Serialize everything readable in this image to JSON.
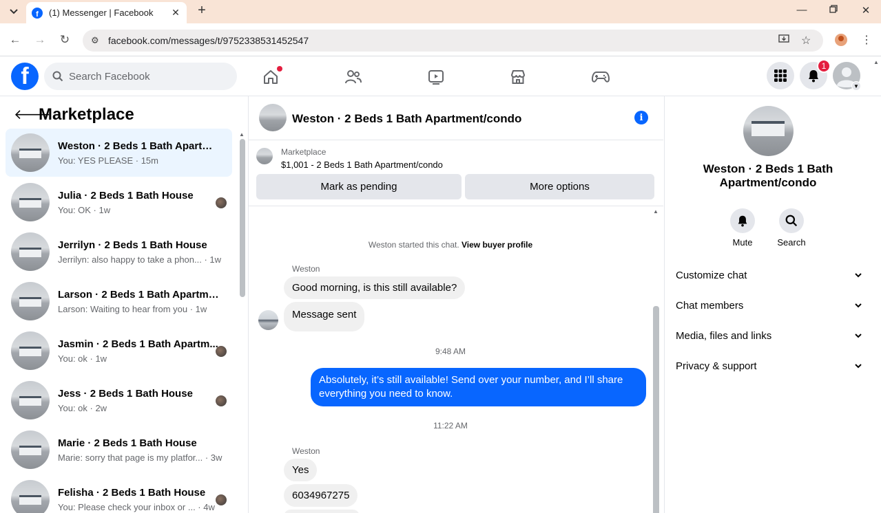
{
  "browser": {
    "tab_title": "(1) Messenger | Facebook",
    "url": "facebook.com/messages/t/9752338531452547"
  },
  "fb": {
    "search_placeholder": "Search Facebook",
    "notification_count": "1"
  },
  "marketplace": {
    "title": "Marketplace",
    "conversations": [
      {
        "name": "Weston · 2 Beds 1 Bath Apartme...",
        "snippet": "You: YES PLEASE · 15m",
        "active": true,
        "mini_avatar": false
      },
      {
        "name": "Julia · 2 Beds 1 Bath House",
        "snippet": "You: OK · 1w",
        "active": false,
        "mini_avatar": true
      },
      {
        "name": "Jerrilyn · 2 Beds 1 Bath House",
        "snippet": "Jerrilyn: also happy to take a phon... · 1w",
        "active": false,
        "mini_avatar": false
      },
      {
        "name": "Larson · 2 Beds 1 Bath Apartmen...",
        "snippet": "Larson: Waiting to hear from you · 1w",
        "active": false,
        "mini_avatar": false
      },
      {
        "name": "Jasmin · 2 Beds 1 Bath Apartm...",
        "snippet": "You: ok · 1w",
        "active": false,
        "mini_avatar": true
      },
      {
        "name": "Jess · 2 Beds 1 Bath House",
        "snippet": "You: ok · 2w",
        "active": false,
        "mini_avatar": true
      },
      {
        "name": "Marie · 2 Beds 1 Bath House",
        "snippet": "Marie: sorry that page is my platfor... · 3w",
        "active": false,
        "mini_avatar": false
      },
      {
        "name": "Felisha · 2 Beds 1 Bath House",
        "snippet": "You: Please check your inbox or ... · 4w",
        "active": false,
        "mini_avatar": true
      }
    ]
  },
  "chat": {
    "title": "Weston · 2 Beds 1 Bath Apartment/condo",
    "listing_label": "Marketplace",
    "listing_price": "$1,001 - 2 Beds 1 Bath Apartment/condo",
    "mark_pending": "Mark as pending",
    "more_options": "More options",
    "system_prefix": "Weston started this chat.",
    "system_link": "View buyer profile",
    "sender_1": "Weston",
    "msg_1": "Good morning, is this still available?",
    "msg_2": "Message sent",
    "time_1": "9:48 AM",
    "msg_out": "Absolutely, it’s still available! Send over your number, and I’ll share everything you need to know.",
    "time_2": "11:22 AM",
    "sender_2": "Weston",
    "msg_3": "Yes",
    "msg_4": "6034967275"
  },
  "details": {
    "title": "Weston · 2 Beds 1 Bath Apartment/condo",
    "mute": "Mute",
    "search": "Search",
    "rows": [
      "Customize chat",
      "Chat members",
      "Media, files and links",
      "Privacy & support"
    ]
  },
  "colors": {
    "brand": "#0866ff",
    "alert": "#e41e3f",
    "active_row": "#ebf5ff"
  }
}
